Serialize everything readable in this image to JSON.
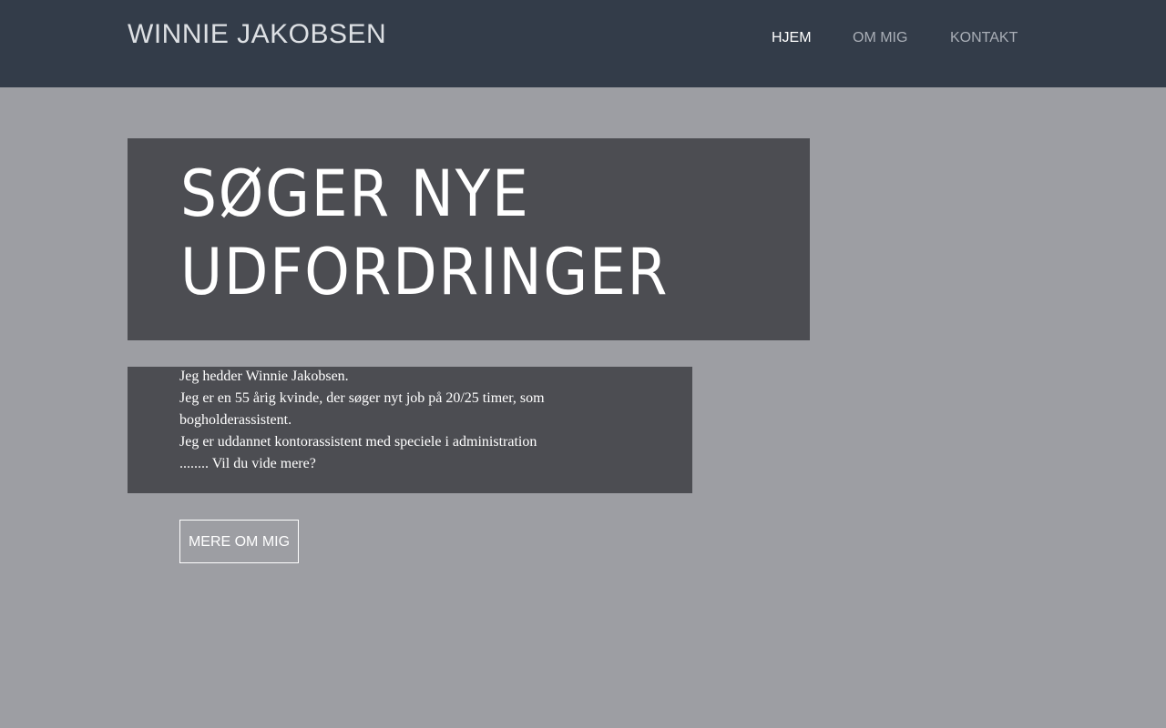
{
  "header": {
    "site_title": "WINNIE JAKOBSEN",
    "nav": [
      {
        "label": "HJEM",
        "active": true
      },
      {
        "label": "OM MIG",
        "active": false
      },
      {
        "label": "KONTAKT",
        "active": false
      }
    ]
  },
  "hero": {
    "title_line1": "SØGER NYE",
    "title_line2": "UDFORDRINGER"
  },
  "intro": {
    "lines": [
      "Jeg hedder Winnie Jakobsen.",
      "Jeg er en 55 årig kvinde, der søger nyt job på 20/25 timer, som bogholderassistent.",
      "Jeg er uddannet kontorassistent med speciele i administration",
      "........ Vil du vide mere?"
    ]
  },
  "cta": {
    "label": "MERE OM MIG"
  },
  "colors": {
    "header_bg": "#333c49",
    "page_bg": "#9d9ea3",
    "box_bg": "#4c4d52",
    "nav_inactive": "#a9aeb6",
    "nav_active": "#ffffff"
  }
}
